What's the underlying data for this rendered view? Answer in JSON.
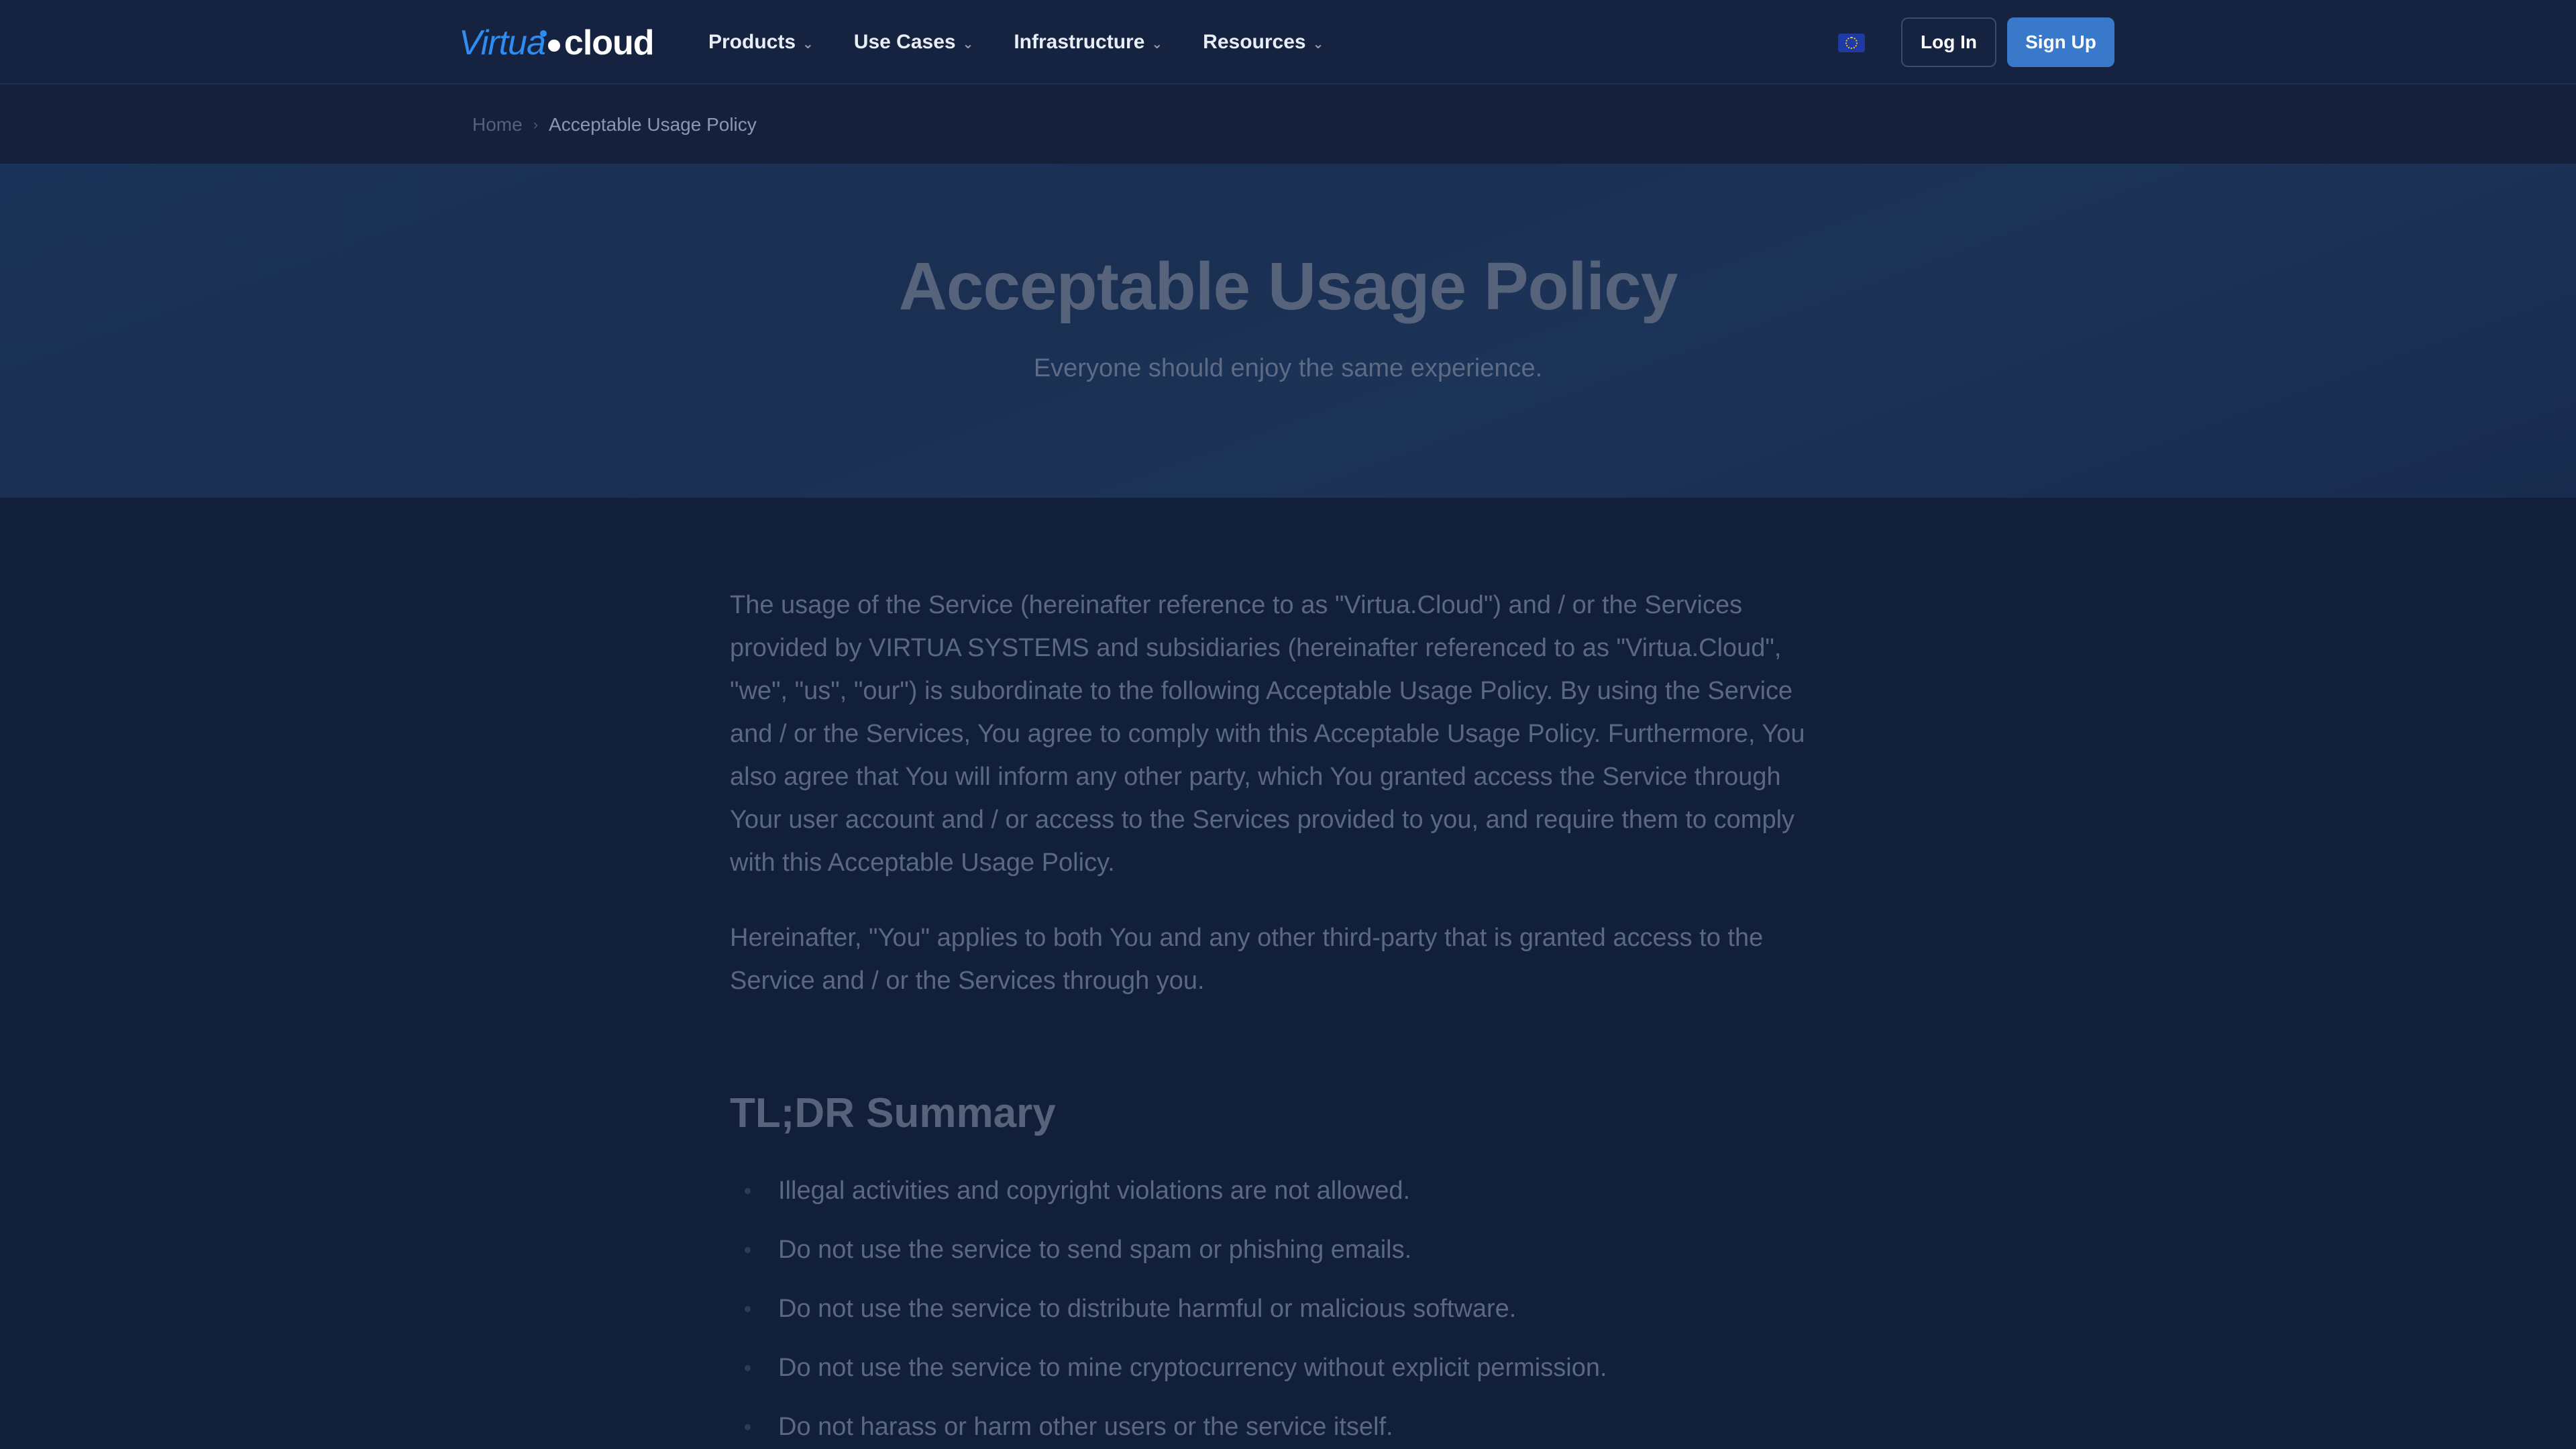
{
  "header": {
    "logo": {
      "part1": "Virtua",
      "part2": "cloud"
    },
    "nav": [
      {
        "label": "Products",
        "icon": "chevron-down-icon"
      },
      {
        "label": "Use Cases",
        "icon": "chevron-down-icon"
      },
      {
        "label": "Infrastructure",
        "icon": "chevron-down-icon"
      },
      {
        "label": "Resources",
        "icon": "chevron-down-icon"
      }
    ],
    "language_icon": "eu-flag-icon",
    "login_label": "Log In",
    "signup_label": "Sign Up"
  },
  "breadcrumb": {
    "home": "Home",
    "current": "Acceptable Usage Policy"
  },
  "hero": {
    "title": "Acceptable Usage Policy",
    "subtitle": "Everyone should enjoy the same experience."
  },
  "content": {
    "paragraphs": [
      "The usage of the Service (hereinafter reference to as \"Virtua.Cloud\") and / or the Services provided by VIRTUA SYSTEMS and subsidiaries (hereinafter referenced to as \"Virtua.Cloud\", \"we\", \"us\", \"our\") is subordinate to the following Acceptable Usage Policy. By using the Service and / or the Services, You agree to comply with this Acceptable Usage Policy. Furthermore, You also agree that You will inform any other party, which You granted access the Service through Your user account and / or access to the Services provided to you, and require them to comply with this Acceptable Usage Policy.",
      "Hereinafter, \"You\" applies to both You and any other third-party that is granted access to the Service and / or the Services through you."
    ],
    "summary_heading": "TL;DR Summary",
    "summary_items": [
      "Illegal activities and copyright violations are not allowed.",
      "Do not use the service to send spam or phishing emails.",
      "Do not use the service to distribute harmful or malicious software.",
      "Do not use the service to mine cryptocurrency without explicit permission.",
      "Do not harass or harm other users or the service itself."
    ]
  },
  "colors": {
    "background": "#121f3b",
    "accent": "#3a78c9",
    "logo_blue": "#2f8cf0"
  }
}
